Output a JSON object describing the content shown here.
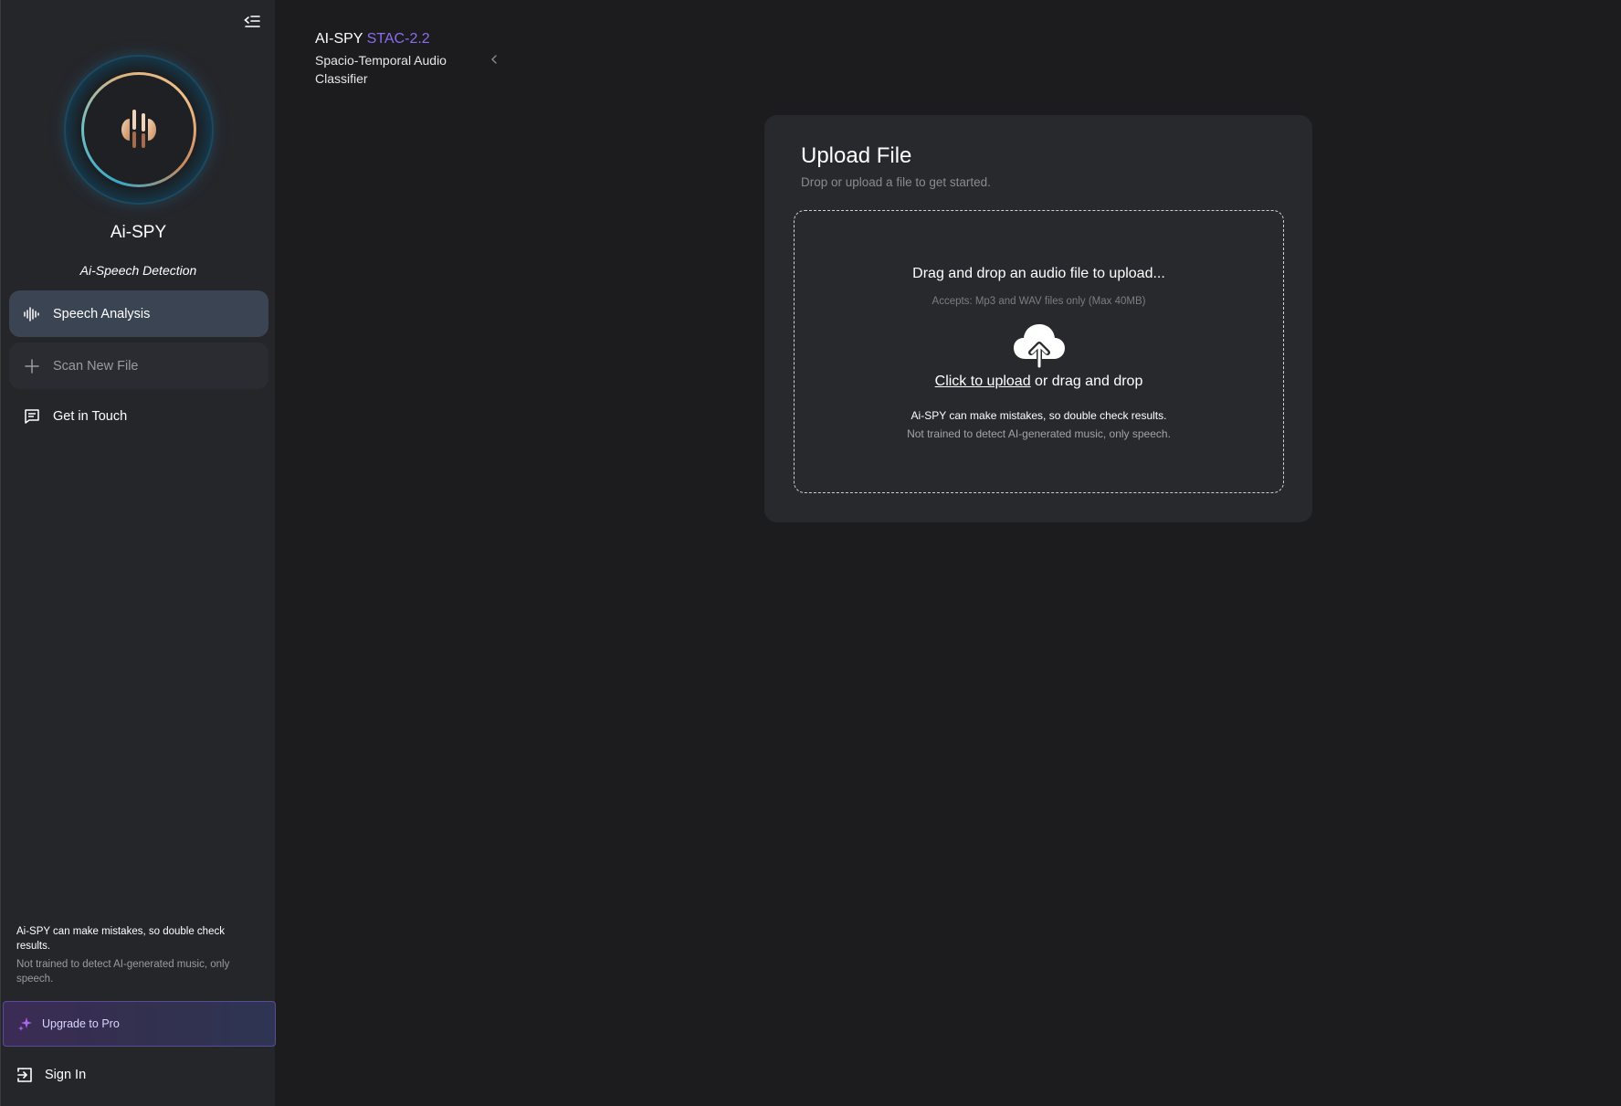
{
  "sidebar": {
    "brand_name": "Ai-SPY",
    "brand_tagline": "Ai-Speech Detection",
    "nav": {
      "speech_analysis": "Speech Analysis",
      "scan_new_file": "Scan New File",
      "get_in_touch": "Get in Touch"
    },
    "notice_line1": "Ai-SPY can make mistakes, so double check results.",
    "notice_line2": "Not trained to detect AI-generated music, only speech.",
    "upgrade_label": "Upgrade to Pro",
    "signin_label": "Sign In",
    "icons": {
      "collapse": "collapse-sidebar-icon",
      "speech": "waveform-icon",
      "scan": "plus-icon",
      "contact": "message-icon",
      "upgrade": "sparkle-icon",
      "signin": "sign-in-icon"
    }
  },
  "header": {
    "title_prefix": "AI-SPY",
    "title_version": "STAC-2.2",
    "subtitle": "Spacio-Temporal Audio Classifier"
  },
  "upload": {
    "title": "Upload File",
    "subtitle": "Drop or upload a file to get started.",
    "drop_title": "Drag and drop an audio file to upload...",
    "accepts": "Accepts: Mp3 and WAV files only (Max 40MB)",
    "click_link": "Click to upload",
    "click_rest": " or drag and drop",
    "warning1": "Ai-SPY can make mistakes, so double check results.",
    "warning2": "Not trained to detect AI-generated music, only speech."
  },
  "colors": {
    "background": "#1c1c1e",
    "sidebar": "#25262a",
    "active_nav": "#3a4453",
    "accent_purple": "#8c6cf0",
    "card": "#28292d"
  }
}
